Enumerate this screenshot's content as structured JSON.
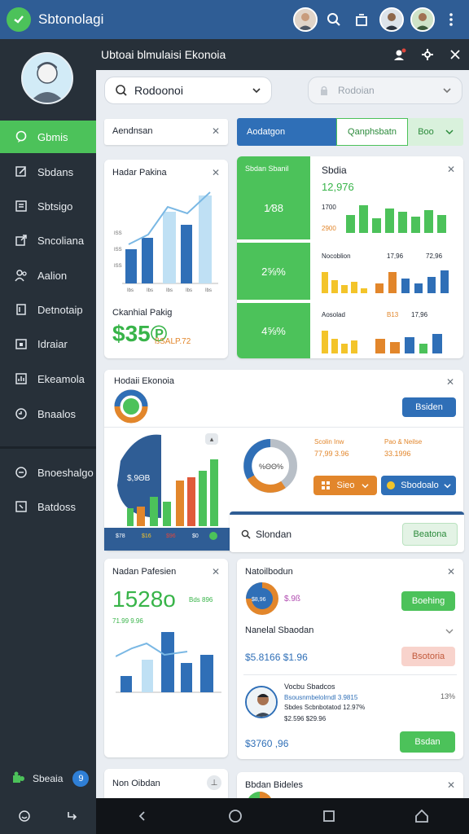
{
  "app": {
    "title": "Sbtonolagi",
    "window_title": "Ubtoai blmulaisi Ekonoia"
  },
  "sidebar": {
    "items": [
      {
        "label": "Gbmis"
      },
      {
        "label": "Sbdans"
      },
      {
        "label": "Sbtsigo"
      },
      {
        "label": "Sncoliana"
      },
      {
        "label": "Aalion"
      },
      {
        "label": "Detnotaip"
      },
      {
        "label": "Idraiar"
      },
      {
        "label": "Ekeamola"
      },
      {
        "label": "Bnaalos"
      },
      {
        "label": "Bnoeshalgo"
      },
      {
        "label": "Batdoss"
      }
    ],
    "footer_label": "Sbeaia",
    "footer_badge": "9"
  },
  "search": {
    "value": "Rodoonoi",
    "right_placeholder": "Rodoian"
  },
  "filters": {
    "left": "Aendnsan",
    "tab1": "Aodatgon",
    "tab2": "Qanphsbatn",
    "tab3": "Boo"
  },
  "card1": {
    "title": "Hadar Pakina",
    "sub": "Ckanhial Pakig",
    "value": "$35℗",
    "delta": "ßSALP.72"
  },
  "card1_chart": {
    "y1": "ISS",
    "y2": "ISS",
    "y3": "ISS",
    "x1": "Ibs",
    "x2": "Ibs",
    "x3": "Ibs",
    "x4": "Ibs",
    "x5": "Ibs"
  },
  "card2": {
    "left1_title": "Sbdan Sbanil",
    "left1_value": "1⁄88",
    "left2_value": "2⅝%",
    "left3_value": "4⅝%",
    "title": "Sbdia",
    "value": "12,976",
    "sub": "2900",
    "mid": "1700",
    "row2_l": "Nocoblion",
    "row2_m": "17,96",
    "row2_r": "72,96",
    "row3_l": "Aosolad",
    "row3_m": "B13",
    "row3_r": "17,96"
  },
  "card3": {
    "title": "Hodaii Ekonoia",
    "button": "Bsiden",
    "pie_label": "$,9ΘB",
    "donut_label": "%ΘΘ%",
    "stat1_label": "Scolin Inw",
    "stat1_value": "77,99 3.96",
    "stat2_label": "Pao & Neilse",
    "stat2_value": "33.1996",
    "btn_orange": "Sieo",
    "btn_blue": "Sbodoalo",
    "legend1": "$78",
    "legend2": "$16",
    "legend3": "$96",
    "legend4": "$0"
  },
  "search2": {
    "placeholder": "Slondan",
    "button": "Beatona"
  },
  "card4": {
    "title": "Nadan Pafesien",
    "value": "1528o",
    "side": "Bds 896",
    "sub": "71.99 9.96"
  },
  "card5": {
    "title": "Natoilbodun",
    "pie_value": "$8,96",
    "button1": "Boehing",
    "row2_title": "Nanelal Sbaodan",
    "row2_value": "$5.8166 $1.96",
    "button2": "Bsotoria",
    "person_name": "Vocbu Sbadcos",
    "person_line1": "Bsousnmbelolrndl 3.9815",
    "person_line2": "Sbdes Scbnbotatod 12.97%",
    "person_line3": "$2.596 $29.96",
    "person_side": "13%",
    "foot_value": "$3760 ,96",
    "button3": "Bsdan"
  },
  "bottom_cards": {
    "left": "Non Oibdan",
    "right": "Bbdan Bideles"
  },
  "colors": {
    "accent": "#4cc25a",
    "header": "#2f5d95",
    "sidebar": "#273039",
    "blue": "#2f6fb7",
    "orange": "#e2862b"
  }
}
